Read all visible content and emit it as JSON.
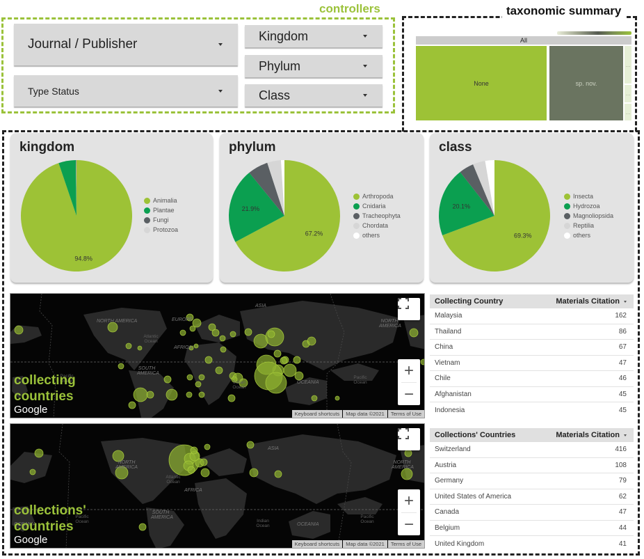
{
  "controllers": {
    "section_label": "controllers",
    "journal_publisher": "Journal / Publisher",
    "type_status": "Type Status",
    "kingdom": "Kingdom",
    "phylum": "Phylum",
    "class": "Class"
  },
  "taxonomic_summary": {
    "section_label": "taxonomic summary",
    "root_label": "All",
    "cells": [
      {
        "label": "None",
        "color": "#9dc236"
      },
      {
        "label": "sp. nov.",
        "color": "#6a7460"
      },
      {
        "label": "..."
      },
      {
        "label": "..."
      },
      {
        "label": "..."
      }
    ]
  },
  "chart_data": [
    {
      "type": "pie",
      "title": "kingdom",
      "categories": [
        "Animalia",
        "Plantae",
        "Fungi",
        "Protozoa"
      ],
      "values": [
        94.8,
        5.0,
        0.1,
        0.1
      ],
      "colors": [
        "#9dc236",
        "#0b9f50",
        "#5a5f63",
        "#d6d6d6"
      ],
      "data_labels": [
        {
          "category": "Animalia",
          "text": "94.8%"
        }
      ],
      "legend": "right"
    },
    {
      "type": "pie",
      "title": "phylum",
      "categories": [
        "Arthropoda",
        "Cnidaria",
        "Tracheophyta",
        "Chordata",
        "others"
      ],
      "values": [
        67.2,
        21.9,
        5.9,
        4.0,
        1.0
      ],
      "colors": [
        "#9dc236",
        "#0b9f50",
        "#5a5f63",
        "#d6d6d6",
        "#ffffff"
      ],
      "data_labels": [
        {
          "category": "Arthropoda",
          "text": "67.2%"
        },
        {
          "category": "Cnidaria",
          "text": "21.9%"
        }
      ],
      "legend": "right"
    },
    {
      "type": "pie",
      "title": "class",
      "categories": [
        "Insecta",
        "Hydrozoa",
        "Magnoliopsida",
        "Reptilia",
        "others"
      ],
      "values": [
        69.3,
        20.1,
        4.3,
        3.6,
        2.7
      ],
      "colors": [
        "#9dc236",
        "#0b9f50",
        "#5a5f63",
        "#d6d6d6",
        "#ffffff"
      ],
      "data_labels": [
        {
          "category": "Insecta",
          "text": "69.3%"
        },
        {
          "category": "Hydrozoa",
          "text": "20.1%"
        }
      ],
      "legend": "right"
    }
  ],
  "maps": [
    {
      "title_line1": "collecting",
      "title_line2": "countries",
      "logo": "Google",
      "attribution": [
        "Keyboard shortcuts",
        "Map data ©2021",
        "Terms of Use"
      ],
      "zoom_in": "+",
      "zoom_out": "−",
      "continents": [
        "NORTH AMERICA",
        "EUROPE",
        "ASIA",
        "AFRICA",
        "SOUTH AMERICA",
        "OCEANIA",
        "NORTH AMERICA"
      ],
      "oceans": [
        "Atlantic Ocean",
        "Indian Ocean",
        "Pacific Ocean",
        "Pacific Ocean"
      ]
    },
    {
      "title_line1": "collections'",
      "title_line2": "countries",
      "logo": "Google",
      "attribution": [
        "Keyboard shortcuts",
        "Map data ©2021",
        "Terms of Use"
      ],
      "zoom_in": "+",
      "zoom_out": "−",
      "continents": [
        "NORTH AMERICA",
        "ASIA",
        "AFRICA",
        "SOUTH AMERICA",
        "OCEANIA",
        "OCEANIA",
        "NORTH AMERICA"
      ],
      "oceans": [
        "Atlantic Ocean",
        "Indian Ocean",
        "Pacific Ocean",
        "Pacific Ocean"
      ]
    }
  ],
  "tables": [
    {
      "col1": "Collecting Country",
      "col2": "Materials Citation",
      "rows": [
        {
          "name": "Malaysia",
          "value": "162"
        },
        {
          "name": "Thailand",
          "value": "86"
        },
        {
          "name": "China",
          "value": "67"
        },
        {
          "name": "Vietnam",
          "value": "47"
        },
        {
          "name": "Chile",
          "value": "46"
        },
        {
          "name": "Afghanistan",
          "value": "45"
        },
        {
          "name": "Indonesia",
          "value": "45"
        }
      ]
    },
    {
      "col1": "Collections' Countries",
      "col2": "Materials Citation",
      "rows": [
        {
          "name": "Switzerland",
          "value": "416"
        },
        {
          "name": "Austria",
          "value": "108"
        },
        {
          "name": "Germany",
          "value": "79"
        },
        {
          "name": "United States of America",
          "value": "62"
        },
        {
          "name": "Canada",
          "value": "47"
        },
        {
          "name": "Belgium",
          "value": "44"
        },
        {
          "name": "United Kingdom",
          "value": "41"
        }
      ]
    }
  ],
  "colors": {
    "accent_green": "#9bc23a",
    "dark_green": "#0b9f50",
    "grey": "#5a5f63"
  }
}
